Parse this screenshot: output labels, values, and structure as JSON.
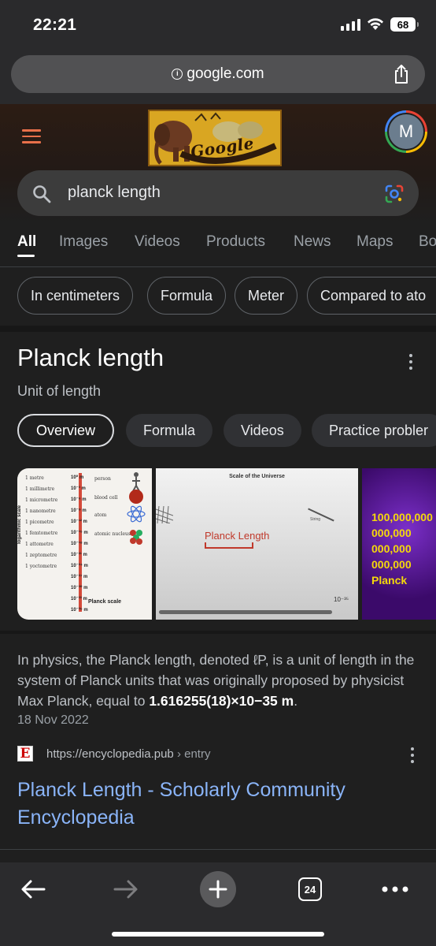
{
  "status_bar": {
    "time": "22:21",
    "battery": "68"
  },
  "browser": {
    "url": "google.com"
  },
  "google": {
    "doodle_text": "Google",
    "avatar_letter": "M",
    "search_query": "planck length"
  },
  "tabs": [
    "All",
    "Images",
    "Videos",
    "Products",
    "News",
    "Maps",
    "Bo"
  ],
  "chips": [
    "In centimeters",
    "Formula",
    "Meter",
    "Compared to ato"
  ],
  "knowledge_panel": {
    "title": "Planck length",
    "subtitle": "Unit of length",
    "chips": [
      "Overview",
      "Formula",
      "Videos",
      "Practice probler"
    ]
  },
  "images": {
    "img1": {
      "axis_label": "logarithmic scale",
      "rows": [
        "1 metre",
        "1 millimetre",
        "1 micrometre",
        "1 nanometre",
        "1 picometre",
        "1 femtometre",
        "1 attometre",
        "1 zeptometre",
        "1 yoctometre"
      ],
      "ruler_labels": [
        "10⁰ m",
        "10⁻³ m",
        "10⁻⁶ m",
        "10⁻⁹ m",
        "10⁻¹² m",
        "10⁻¹⁵ m",
        "10⁻¹⁸ m",
        "10⁻²¹ m",
        "10⁻²⁴ m",
        "10⁻²⁷ m",
        "10⁻³⁰ m",
        "10⁻³³ m",
        "10⁻³⁵ m"
      ],
      "side_labels": [
        "person",
        "blood cell",
        "atom",
        "atomic nucleus"
      ],
      "bottom_label": "Planck scale"
    },
    "img2": {
      "title": "Scale of the Universe",
      "label": "Planck Length",
      "string_label": "String",
      "exponent": "10⁻³⁵"
    },
    "img3": {
      "text": "100,000,000\n000,000\n000,000\n000,000\nPlanck"
    }
  },
  "description": {
    "text": "In physics, the Planck length, denoted ℓP, is a unit of length in the system of Planck units that was originally proposed by physicist Max Planck, equal to ",
    "bold": "1.616255(18)×10−35 m",
    "end": ".",
    "date": "18 Nov 2022"
  },
  "result": {
    "site_icon_letter": "E",
    "url": "https://encyclopedia.pub",
    "breadcrumb": "› entry",
    "title": "Planck Length - Scholarly Community Encyclopedia"
  },
  "toolbar": {
    "tab_count": "24"
  },
  "colors": {
    "link": "#8ab4f8",
    "background": "#1f1f1f",
    "hamburger": "#e8704a"
  }
}
